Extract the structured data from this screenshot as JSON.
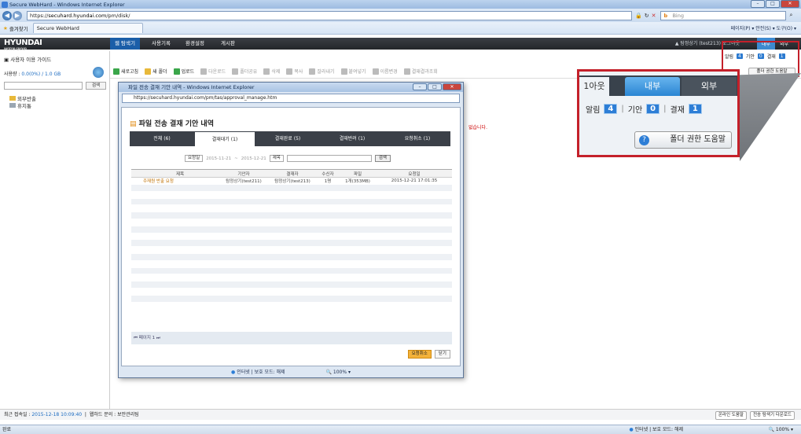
{
  "browser": {
    "title": "Secure WebHard - Windows Internet Explorer",
    "url_prefix": "https://",
    "url_host": "secuhard.hyundai.com",
    "url_path": "/pm/disk/",
    "search_placeholder": "Bing",
    "favorites_label": "즐겨찾기",
    "tab_label": "Secure WebHard",
    "commands": "페이지(P) ▾   안전(S) ▾   도구(O) ▾"
  },
  "app": {
    "logo": "HYUNDAI",
    "logo_sub": "MOTOR GROUP",
    "nav": [
      "웹 탐색기",
      "사용기록",
      "환경설정",
      "게시판"
    ],
    "user": "▲ 탐정상기 (test213)",
    "logout": "로그아웃",
    "scope_tabs": [
      "내부",
      "외부"
    ]
  },
  "sidebar": {
    "title": "사용자 이용 가이드",
    "usage_label": "사용량 :",
    "usage_value": "0.0(0%) / 1.0 GB",
    "search_button": "검색",
    "folders": [
      "외부반출",
      "휴지통"
    ]
  },
  "toolbar": [
    "새로고침",
    "새 폴더",
    "업로드",
    "다운로드",
    "폴더공유",
    "삭제",
    "복사",
    "잘라내기",
    "붙여넣기",
    "이름변경",
    "결재결과조회"
  ],
  "main": {
    "message": "없습니다.",
    "mini": {
      "alert": "알림",
      "alert_n": "4",
      "term": "기안",
      "term_n": "0",
      "approve": "결재",
      "approve_n": "1"
    },
    "help_button": "폴더 권한 도움말"
  },
  "callout": {
    "tab_partial": "1아웃",
    "tab_inner": "내부",
    "tab_outer": "외부",
    "alert": "알림",
    "alert_n": "4",
    "term": "기안",
    "term_n": "0",
    "approve": "결재",
    "approve_n": "1",
    "help": "폴더 권한 도움말"
  },
  "popup": {
    "title": "파일 전송 결재 기안 내역 - Windows Internet Explorer",
    "url": "https://secuhard.hyundai.com/pm/tas/approval_manage.htm",
    "heading": "파일 전송 결재 기안 내역",
    "tabs": [
      "전체 (6)",
      "결재대기 (1)",
      "결재완료 (5)",
      "결재반려 (1)",
      "요청취소 (1)"
    ],
    "filter": {
      "date_type": "요청일",
      "from": "2015-11-21",
      "to": "2015-12-21",
      "field": "제목",
      "search": "검색"
    },
    "columns": [
      "",
      "제목",
      "기안자",
      "결재자",
      "수신자",
      "파일",
      "요청일"
    ],
    "rows": [
      [
        "",
        "주재원 반출 요청",
        "탐정상기(test211)",
        "탐정상기(test213)",
        "1명",
        "1개(353MB)",
        "2015-12-21 17:01:35"
      ]
    ],
    "pager": "⏮ 페이지 1 ⏭",
    "buttons": [
      "요청취소",
      "닫기"
    ],
    "status": "인터넷 | 보호 모드: 해제",
    "zoom": "100%"
  },
  "status": {
    "last_login_label": "최근 접속일 :",
    "last_login": "2015-12-18 10:09:40",
    "contact": "웹하드 문의 : 보안관리팀",
    "online_help": "온라인 도움말",
    "install": "전송 탐색기 다운로드",
    "ie_left": "완료",
    "ie_protect": "인터넷 | 보호 모드: 해제",
    "ie_zoom": "100%"
  },
  "colors": {
    "accent": "#2b7ad0",
    "callout_border": "#c4202a",
    "nav_bg": "#23262a"
  }
}
